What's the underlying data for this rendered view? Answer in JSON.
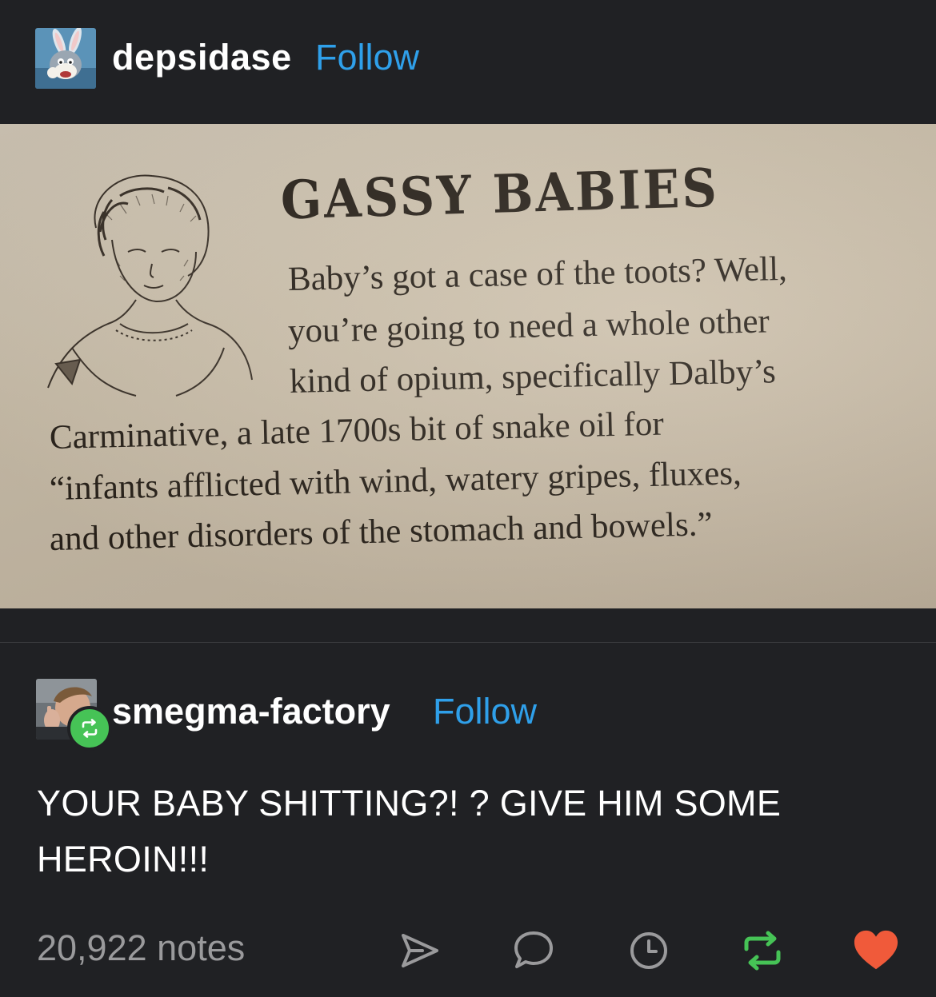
{
  "post": {
    "username": "depsidase",
    "follow_label": "Follow",
    "image": {
      "title": "GASSY BABIES",
      "lines": [
        "Baby’s got a case of the toots? Well,",
        "you’re going to need a whole other",
        "kind of opium, specifically Dalby’s",
        "Carminative, a late 1700s bit of snake oil for",
        "“infants afflicted with wind, watery gripes, fluxes,",
        "and other disorders of the stomach and bowels.”"
      ]
    }
  },
  "reblog": {
    "username": "smegma-factory",
    "follow_label": "Follow",
    "text": "YOUR BABY SHITTING?! ? GIVE HIM SOME HEROIN!!!"
  },
  "footer": {
    "notes": "20,922 notes",
    "actions": [
      "share-icon",
      "comment-icon",
      "schedule-icon",
      "reblog-icon",
      "heart-icon"
    ]
  },
  "colors": {
    "background": "#202124",
    "follow": "#2fa0ea",
    "reblog_green": "#46c356",
    "like_red": "#f05a3a",
    "muted": "#9a9a9c"
  }
}
